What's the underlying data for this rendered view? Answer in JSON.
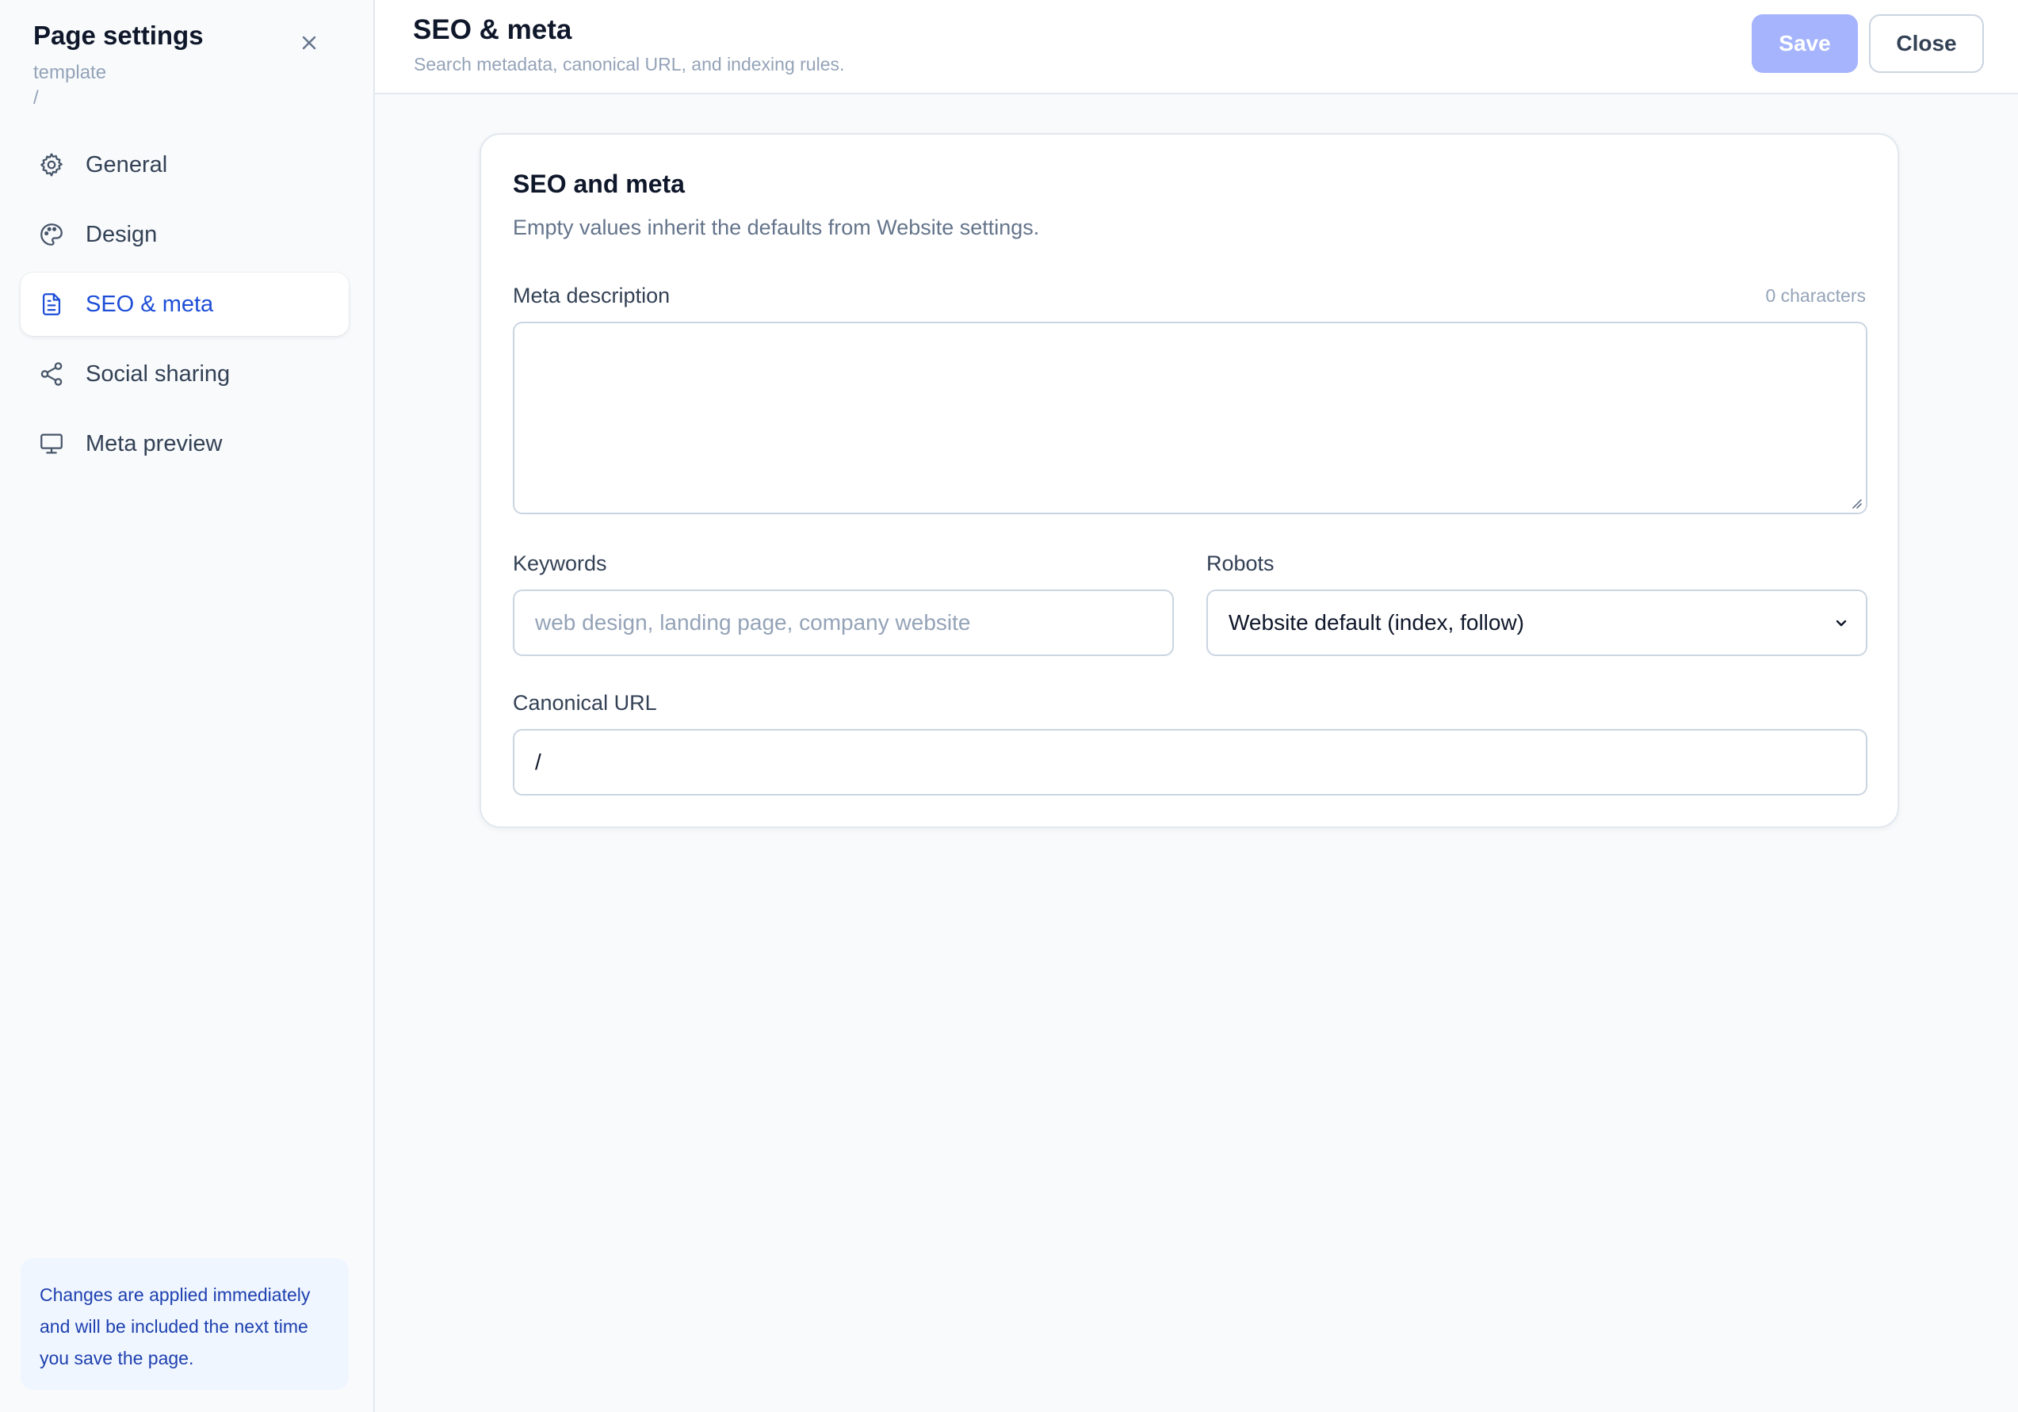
{
  "sidebar": {
    "title": "Page settings",
    "subtitle_type": "template",
    "subtitle_path": "/",
    "close_icon": "close-icon",
    "items": [
      {
        "label": "General",
        "icon": "gear-icon",
        "active": false
      },
      {
        "label": "Design",
        "icon": "palette-icon",
        "active": false
      },
      {
        "label": "SEO & meta",
        "icon": "document-icon",
        "active": true
      },
      {
        "label": "Social sharing",
        "icon": "share-icon",
        "active": false
      },
      {
        "label": "Meta preview",
        "icon": "monitor-icon",
        "active": false
      }
    ],
    "note": "Changes are applied immediately and will be included the next time you save the page."
  },
  "header": {
    "title": "SEO & meta",
    "subtitle": "Search metadata, canonical URL, and indexing rules.",
    "save_label": "Save",
    "close_label": "Close"
  },
  "card": {
    "title": "SEO and meta",
    "description": "Empty values inherit the defaults from Website settings.",
    "meta_description": {
      "label": "Meta description",
      "counter": "0 characters",
      "value": ""
    },
    "keywords": {
      "label": "Keywords",
      "placeholder": "web design, landing page, company website",
      "value": ""
    },
    "robots": {
      "label": "Robots",
      "selected": "Website default (index, follow)"
    },
    "canonical": {
      "label": "Canonical URL",
      "value": "/"
    }
  },
  "colors": {
    "accent": "#1d4ed8",
    "save_disabled": "#a5b4fc",
    "note_bg": "#eff6ff"
  }
}
